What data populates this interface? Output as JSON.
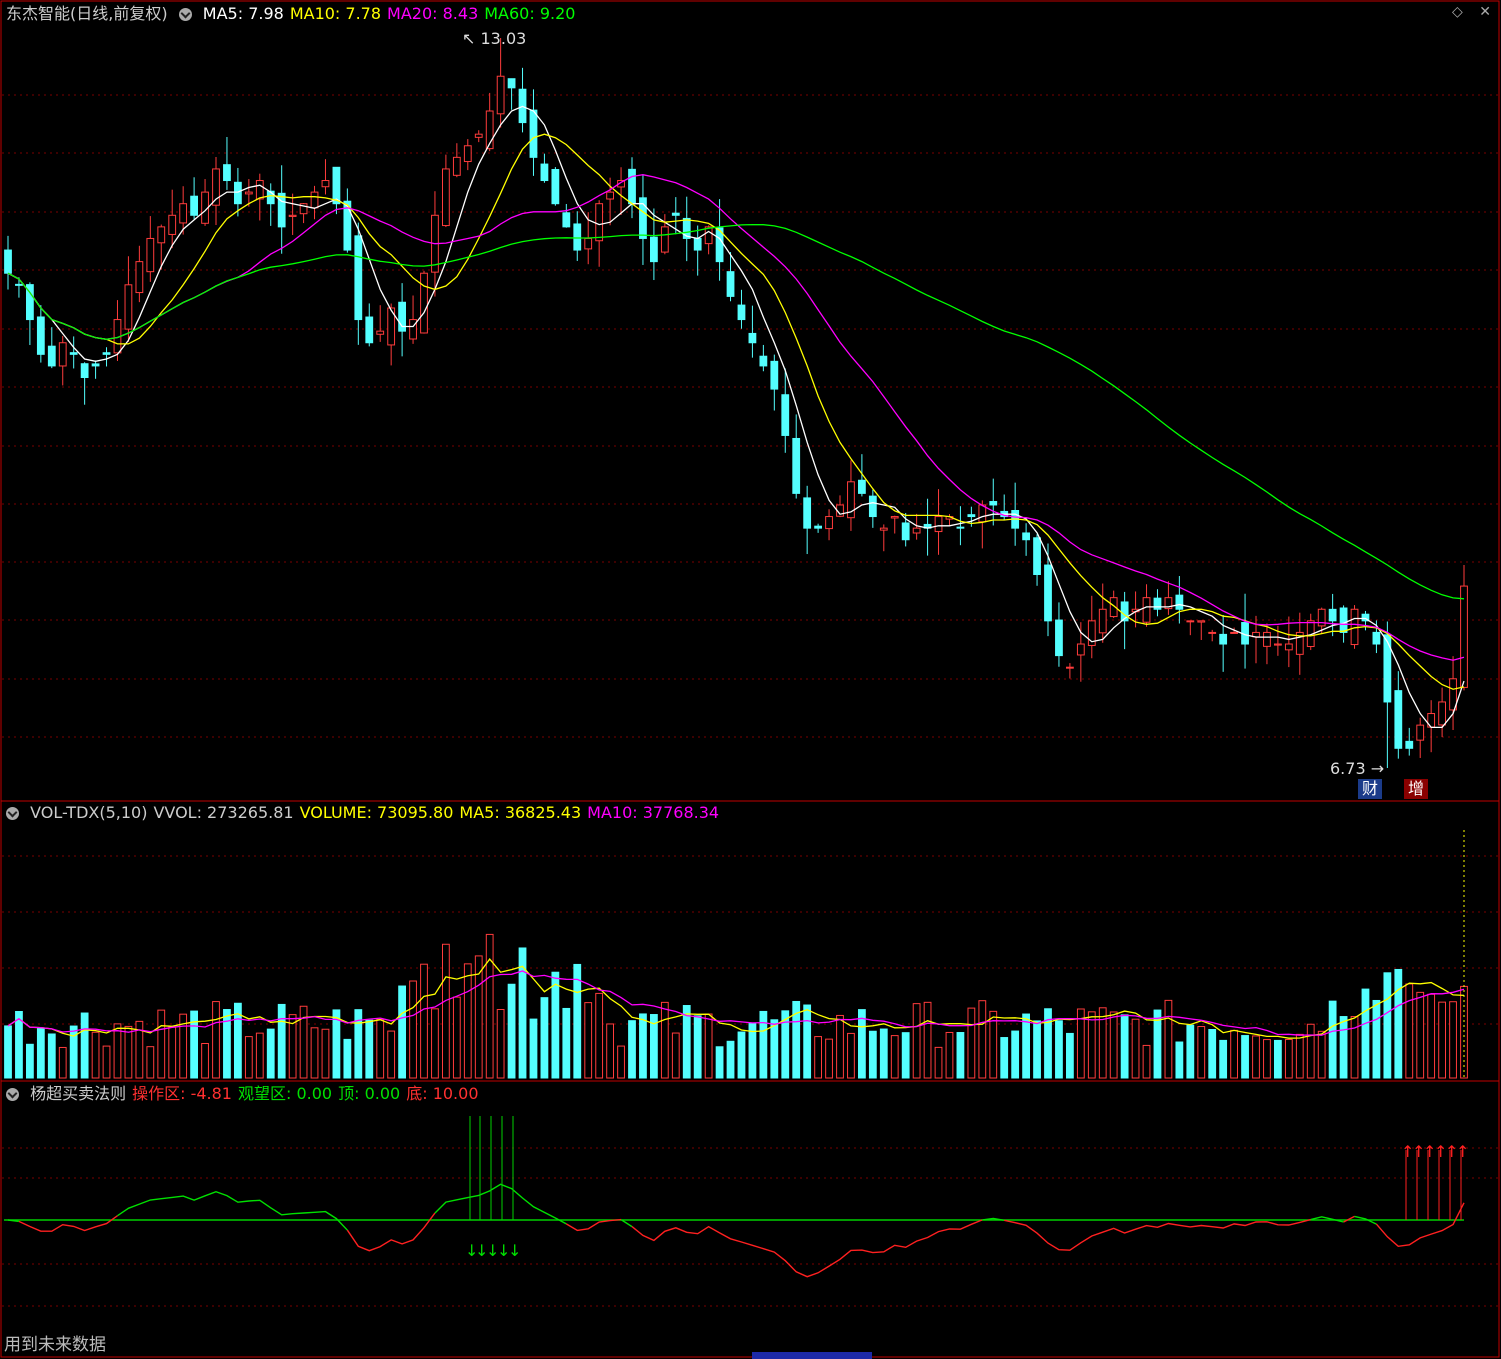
{
  "stock": {
    "name": "东杰智能",
    "period": "(日线,前复权)"
  },
  "price_panel": {
    "ma_labels": [
      {
        "label": "MA5: 7.98",
        "color": "#ffffff"
      },
      {
        "label": "MA10: 7.78",
        "color": "#ffff00"
      },
      {
        "label": "MA20: 8.43",
        "color": "#ff00ff"
      },
      {
        "label": "MA60: 9.20",
        "color": "#00ff00"
      }
    ],
    "high_label": "13.03",
    "low_label": "6.73",
    "badge_cai": "财",
    "badge_zeng": "增"
  },
  "volume_panel": {
    "labels": [
      {
        "label": "VOL-TDX(5,10)",
        "color": "#cccccc"
      },
      {
        "label": "VVOL: 273265.81",
        "color": "#cccccc"
      },
      {
        "label": "VOLUME: 73095.80",
        "color": "#ffff00"
      },
      {
        "label": "MA5: 36825.43",
        "color": "#ffff00"
      },
      {
        "label": "MA10: 37768.34",
        "color": "#ff00ff"
      }
    ]
  },
  "indicator_panel": {
    "labels": [
      {
        "label": "杨超买卖法则",
        "color": "#cccccc"
      },
      {
        "label": "操作区: -4.81",
        "color": "#ff3030"
      },
      {
        "label": "观望区: 0.00",
        "color": "#00e000"
      },
      {
        "label": "顶: 0.00",
        "color": "#00e000"
      },
      {
        "label": "底: 10.00",
        "color": "#ff3030"
      }
    ]
  },
  "footer": {
    "text": "用到未来数据"
  },
  "window_icons": [
    "diamond-icon",
    "close-icon"
  ],
  "colors": {
    "up": "#ff3c3c",
    "down": "#54ffff",
    "grid": "#7a0000",
    "border": "#c00000"
  },
  "chart_data": [
    {
      "type": "candlestick",
      "series": [
        {
          "name": "MA5",
          "values": [
            7.98
          ]
        },
        {
          "name": "MA10",
          "values": [
            7.78
          ]
        },
        {
          "name": "MA20",
          "values": [
            8.43
          ]
        },
        {
          "name": "MA60",
          "values": [
            9.2
          ]
        }
      ],
      "annotations": [
        {
          "text": "13.03",
          "kind": "high"
        },
        {
          "text": "6.73",
          "kind": "low"
        }
      ],
      "price_path": [
        11.0,
        10.9,
        10.6,
        10.3,
        10.2,
        10.4,
        10.3,
        10.1,
        10.2,
        10.3,
        10.6,
        10.9,
        11.1,
        11.3,
        11.4,
        11.5,
        11.6,
        11.5,
        11.7,
        11.9,
        11.8,
        11.6,
        11.7,
        11.8,
        11.6,
        11.4,
        11.5,
        11.6,
        11.7,
        11.8,
        11.6,
        11.2,
        10.6,
        10.4,
        10.5,
        10.7,
        10.5,
        10.6,
        11.0,
        11.5,
        11.9,
        12.0,
        12.1,
        12.2,
        12.4,
        12.7,
        12.6,
        12.3,
        12.0,
        11.8,
        11.6,
        11.4,
        11.2,
        11.3,
        11.6,
        11.7,
        11.8,
        11.6,
        11.3,
        11.1,
        11.4,
        11.5,
        11.3,
        11.2,
        11.4,
        11.1,
        10.8,
        10.6,
        10.4,
        10.2,
        10.0,
        9.6,
        9.1,
        8.8,
        8.8,
        8.9,
        9.0,
        9.2,
        9.1,
        8.9,
        8.8,
        8.9,
        8.7,
        8.8,
        8.8,
        8.9,
        8.9,
        8.8,
        8.9,
        9.0,
        9.0,
        8.9,
        8.8,
        8.7,
        8.4,
        8.0,
        7.7,
        7.6,
        7.8,
        8.0,
        8.1,
        8.2,
        8.0,
        8.1,
        8.2,
        8.1,
        8.2,
        8.1,
        8.0,
        8.0,
        7.9,
        7.8,
        7.9,
        7.8,
        7.9,
        7.9,
        7.8,
        7.8,
        7.9,
        8.0,
        8.1,
        8.0,
        7.9,
        8.1,
        8.0,
        7.8,
        7.3,
        6.9,
        6.9,
        7.1,
        7.2,
        7.3,
        7.5,
        8.3
      ]
    },
    {
      "type": "bar",
      "series": [
        {
          "name": "VOLUME",
          "values": [
            73095.8
          ]
        },
        {
          "name": "MA5",
          "values": [
            36825.43
          ]
        },
        {
          "name": "MA10",
          "values": [
            37768.34
          ]
        }
      ]
    },
    {
      "type": "line",
      "series": [
        {
          "name": "操作区",
          "values": [
            -4.81
          ]
        },
        {
          "name": "观望区",
          "values": [
            0.0
          ]
        },
        {
          "name": "顶",
          "values": [
            0.0
          ]
        },
        {
          "name": "底",
          "values": [
            10.0
          ]
        }
      ]
    }
  ]
}
